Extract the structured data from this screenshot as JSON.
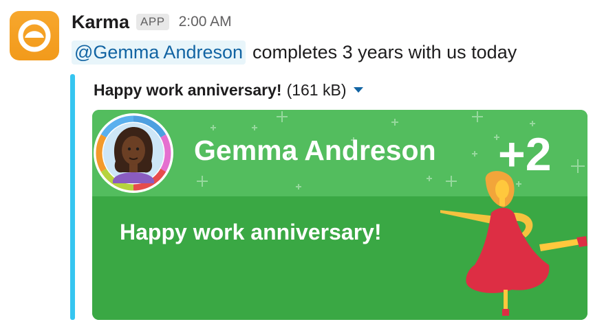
{
  "message": {
    "app_name": "Karma",
    "app_badge": "APP",
    "timestamp": "2:00 AM",
    "mention": "@Gemma Andreson",
    "text": "completes 3 years with us today",
    "app_icon": "karma-logo-icon"
  },
  "attachment": {
    "title": "Happy work anniversary!",
    "size": "(161 kB)",
    "accent_color": "#36c5f0",
    "card": {
      "name": "Gemma Andreson",
      "points": "+2",
      "message": "Happy work anniversary!",
      "background_color": "#41b04b",
      "avatar_icon": "woman-avatar-icon",
      "figure_icon": "dancing-woman-icon"
    }
  }
}
